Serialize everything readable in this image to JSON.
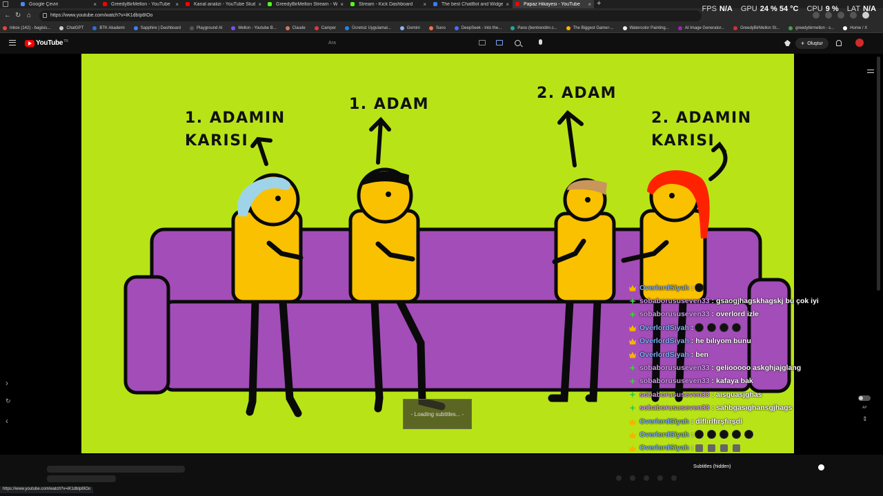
{
  "browser": {
    "tabs": [
      {
        "title": "Google Çeviri",
        "fav": "#4a8af4"
      },
      {
        "title": "GreedyBirMellon - YouTube",
        "fav": "#ff0000"
      },
      {
        "title": "Kanal analizi - YouTube Studio",
        "fav": "#ff0000"
      },
      {
        "title": "GreedyBirMellon Stream - Watch",
        "fav": "#53fc18"
      },
      {
        "title": "Stream - Kick Dashboard",
        "fav": "#53fc18"
      },
      {
        "title": "The best ChatBot and Widgets fo",
        "fav": "#3a7bfd"
      },
      {
        "title": "Papaz Hikayesi - YouTube",
        "fav": "#ff0000",
        "active": true
      }
    ],
    "url": "https://www.youtube.com/watch?v=iK1dbIp8IOo",
    "status_url": "https://www.youtube.com/watch?v=iK1dbIp8IOo",
    "bookmarks": [
      {
        "label": "Inbox (142) - bagisis...",
        "color": "#ea4335"
      },
      {
        "label": "ChatGPT",
        "color": "#cccccc"
      },
      {
        "label": "BTK Akademi",
        "color": "#2f6fd6"
      },
      {
        "label": "Sapphire | Dashboard",
        "color": "#3b82f6"
      },
      {
        "label": "Playground AI",
        "color": "#555555"
      },
      {
        "label": "Mellon - Youtube B...",
        "color": "#7c4dff"
      },
      {
        "label": "Claude",
        "color": "#d97757"
      },
      {
        "label": "Camper",
        "color": "#e53935"
      },
      {
        "label": "Ücretsiz Uygulamal...",
        "color": "#1e88e5"
      },
      {
        "label": "Gemini",
        "color": "#8ab4f8"
      },
      {
        "label": "Suno",
        "color": "#ff7043"
      },
      {
        "label": "DeepSeek - Into the...",
        "color": "#4d6bfe"
      },
      {
        "label": "Pano (bentrendim.c...",
        "color": "#26a69a"
      },
      {
        "label": "The Biggest Gamer-...",
        "color": "#ffb300"
      },
      {
        "label": "Watercolor Painting...",
        "color": "#eeeeee"
      },
      {
        "label": "AI Image Generator...",
        "color": "#9c27b0"
      },
      {
        "label": "GreedyBirMellon St...",
        "color": "#d32f2f"
      },
      {
        "label": "greedybirmellon - s...",
        "color": "#43a047"
      },
      {
        "label": "Home / X",
        "color": "#ffffff"
      }
    ]
  },
  "overlay_stats": {
    "fps_label": "FPS",
    "fps_value": "N/A",
    "gpu_label": "GPU",
    "gpu_value": "24 % 54 °C",
    "cpu_label": "CPU",
    "cpu_value": "9 %",
    "lat_label": "LAT",
    "lat_value": "N/A"
  },
  "youtube": {
    "logo_text": "YouTube",
    "logo_region": "TR",
    "search_placeholder": "Ara",
    "create_label": "Oluştur"
  },
  "video": {
    "captions": {
      "wife1": "1. ADAMIN\nKARISI",
      "man1": "1. ADAM",
      "man2": "2. ADAM",
      "wife2": "2. ADAMIN\nKARISI"
    },
    "loading_text": "- Loading subtitles... -",
    "colors": {
      "background": "#b8e417",
      "couch": "#a34db8",
      "body": "#f9c100"
    }
  },
  "chat": [
    {
      "user": "OverlordSiyah",
      "badge": "crown",
      "text": "",
      "emojis": [
        "black"
      ]
    },
    {
      "user": "sobaborususeven33",
      "badge": "star",
      "text": "gsaogjhagskhagskj bu çok iyi"
    },
    {
      "user": "sobaborususeven33",
      "badge": "star",
      "text": "overlord izle"
    },
    {
      "user": "OverlordSiyah",
      "badge": "crown",
      "text": "",
      "emojis": [
        "black",
        "black",
        "black",
        "black"
      ]
    },
    {
      "user": "OverlordSiyah",
      "badge": "crown",
      "text": "he bılıyom bunu"
    },
    {
      "user": "OverlordSiyah",
      "badge": "crown",
      "text": "ben"
    },
    {
      "user": "sobaborususeven33",
      "badge": "star",
      "text": "geliooooo askghjajglang"
    },
    {
      "user": "sobaborususeven33",
      "badge": "star",
      "text": "kafaya bak"
    },
    {
      "user": "sobaborususeven33",
      "badge": "star",
      "text": "aısguasjghas"
    },
    {
      "user": "sobaborususeven33",
      "badge": "star",
      "text": "sahbgasıghansgjhags"
    },
    {
      "user": "OverlordSiyah",
      "badge": "crown",
      "text": "dlflırlfırşfırşdl"
    },
    {
      "user": "OverlordSiyah",
      "badge": "crown",
      "text": "",
      "emojis": [
        "black",
        "black",
        "black",
        "black",
        "black"
      ]
    },
    {
      "user": "OverlordSiyah",
      "badge": "crown",
      "text": "",
      "emojis": [
        "gray",
        "gray",
        "gray",
        "gray"
      ]
    },
    {
      "user": "OverlordSiyah",
      "badge": "crown",
      "text": "",
      "emojis": [
        "gold",
        "gold",
        "gold",
        "gold"
      ]
    }
  ],
  "player": {
    "subtitles_label": "Subtitles (hidden)",
    "autoplay_label": "AP"
  }
}
